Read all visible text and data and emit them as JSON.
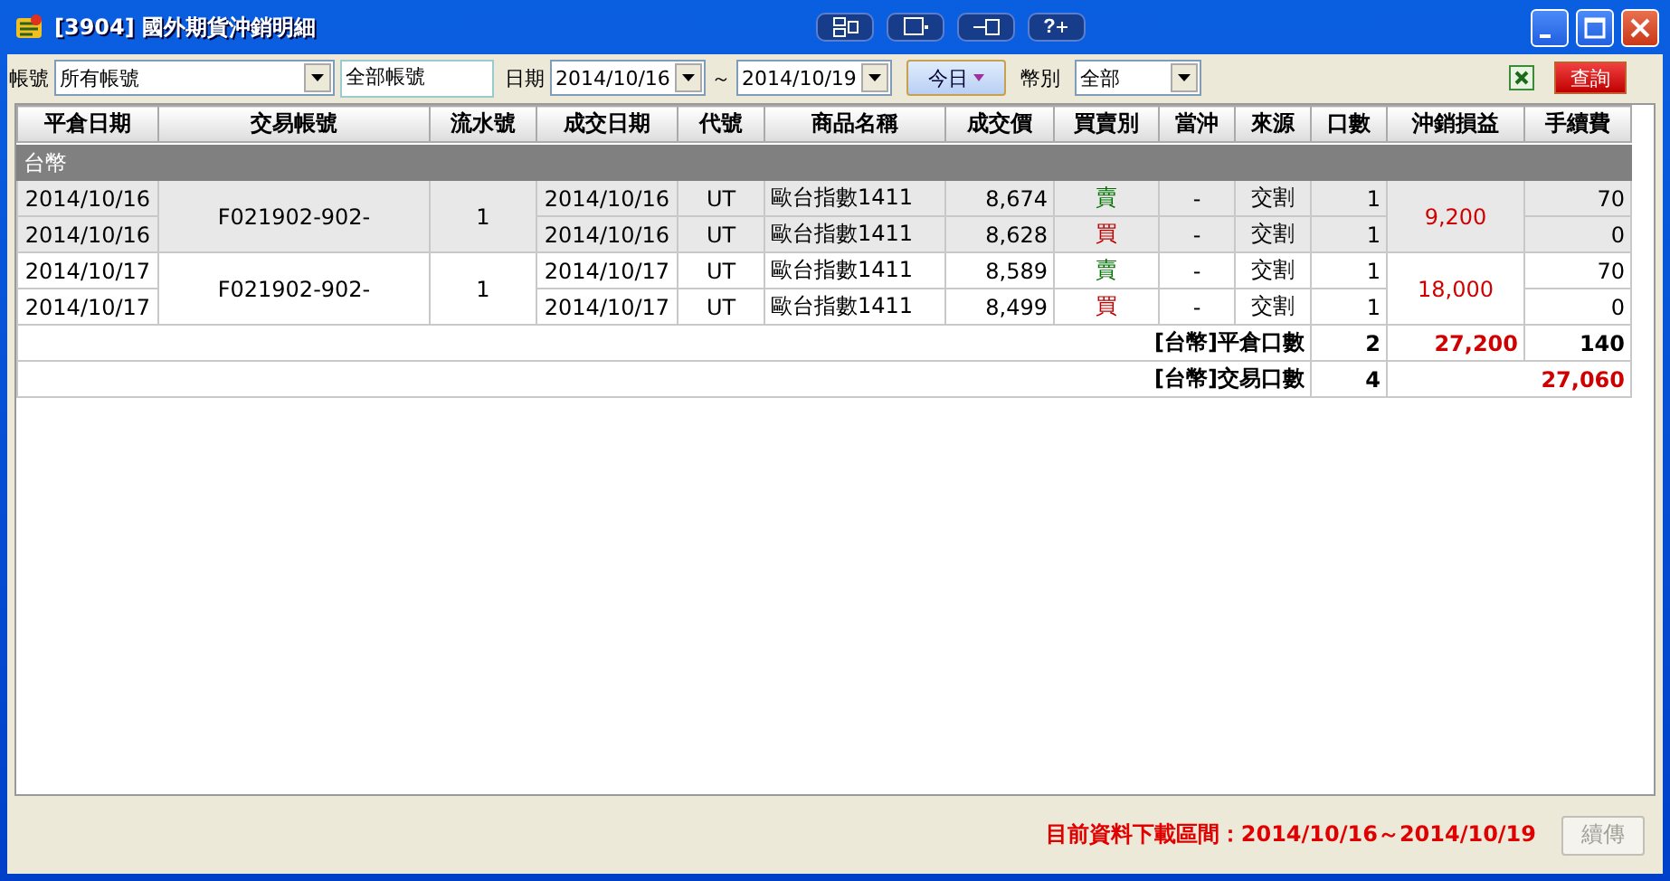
{
  "window": {
    "title": "[3904] 國外期貨沖銷明細",
    "tool_buttons": [
      {
        "kind": "windows"
      },
      {
        "kind": "window"
      },
      {
        "kind": "pin"
      },
      {
        "kind": "help",
        "label": "?"
      }
    ]
  },
  "filters": {
    "account_label": "帳號",
    "account_value": "所有帳號",
    "account_name": "全部帳號",
    "date_label": "日期",
    "date_from": "2014/10/16",
    "date_sep": "～",
    "date_to": "2014/10/19",
    "today_button": "今日",
    "currency_label": "幣別",
    "currency_value": "全部",
    "query_button": "查詢"
  },
  "table": {
    "columns": [
      "平倉日期",
      "交易帳號",
      "流水號",
      "成交日期",
      "代號",
      "商品名稱",
      "成交價",
      "買賣別",
      "當沖",
      "來源",
      "口數",
      "沖銷損益",
      "手續費"
    ],
    "groups": [
      {
        "name": "台幣",
        "trades": [
          {
            "account": "F021902-902-",
            "serial": "1",
            "pnl": "9,200",
            "legs": [
              {
                "close_date": "2014/10/16",
                "trade_date": "2014/10/16",
                "code": "UT",
                "product": "歐台指數1411",
                "price": "8,674",
                "side": {
                  "text": "賣",
                  "kind": "sell"
                },
                "daytrade": "-",
                "source": "交割",
                "lots": "1",
                "fee": "70"
              },
              {
                "close_date": "2014/10/16",
                "trade_date": "2014/10/16",
                "code": "UT",
                "product": "歐台指數1411",
                "price": "8,628",
                "side": {
                  "text": "買",
                  "kind": "buy"
                },
                "daytrade": "-",
                "source": "交割",
                "lots": "1",
                "fee": "0"
              }
            ]
          },
          {
            "account": "F021902-902-",
            "serial": "1",
            "pnl": "18,000",
            "legs": [
              {
                "close_date": "2014/10/17",
                "trade_date": "2014/10/17",
                "code": "UT",
                "product": "歐台指數1411",
                "price": "8,589",
                "side": {
                  "text": "賣",
                  "kind": "sell"
                },
                "daytrade": "-",
                "source": "交割",
                "lots": "1",
                "fee": "70"
              },
              {
                "close_date": "2014/10/17",
                "trade_date": "2014/10/17",
                "code": "UT",
                "product": "歐台指數1411",
                "price": "8,499",
                "side": {
                  "text": "買",
                  "kind": "buy"
                },
                "daytrade": "-",
                "source": "交割",
                "lots": "1",
                "fee": "0"
              }
            ]
          }
        ]
      }
    ],
    "summaries": [
      {
        "kind": "close",
        "label": "[台幣]平倉口數",
        "lots": "2",
        "pnl": "27,200",
        "fee": "140"
      },
      {
        "kind": "trade",
        "label": "[台幣]交易口數",
        "lots": "4",
        "net": "27,060"
      }
    ]
  },
  "status_bar": {
    "message": "目前資料下載區間：2014/10/16～2014/10/19",
    "resume_button": {
      "label": "續傳",
      "disabled": true
    }
  }
}
